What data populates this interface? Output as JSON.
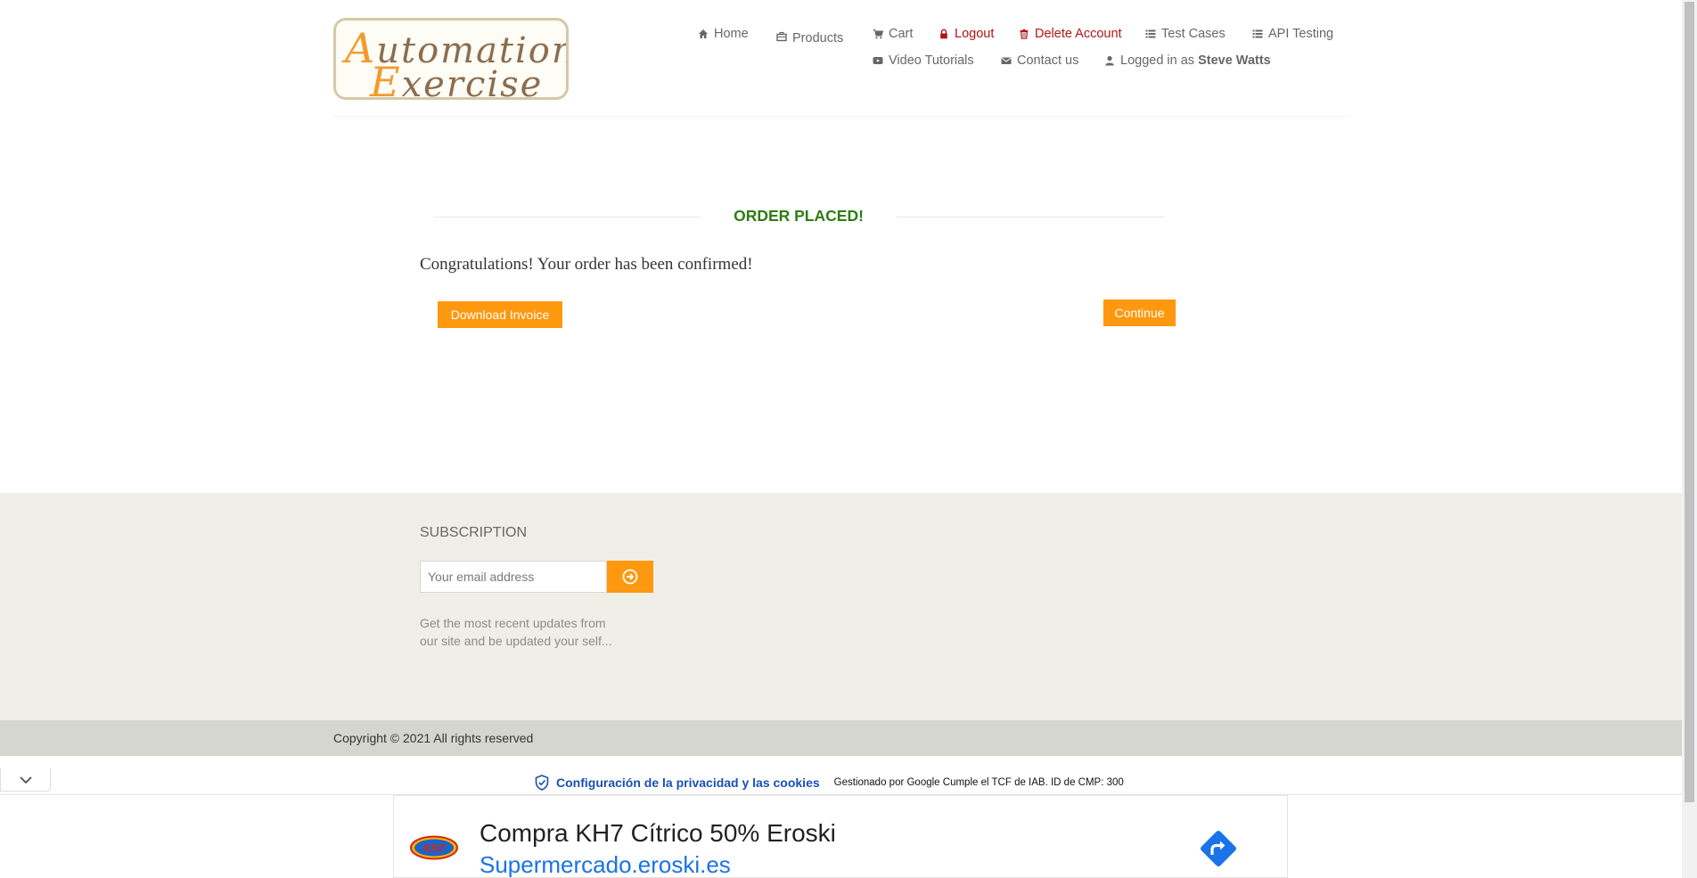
{
  "logo": {
    "line1_cap": "A",
    "line1_rest": "utomation",
    "line2_cap": "E",
    "line2_rest": "xercise"
  },
  "nav": {
    "home": "Home",
    "products": "Products",
    "cart": "Cart",
    "logout": "Logout",
    "delete_account": "Delete Account",
    "test_cases": "Test Cases",
    "api_testing": "API Testing",
    "video_tutorials": "Video Tutorials",
    "contact_us": "Contact us",
    "logged_in_prefix": "Logged in as",
    "logged_in_user": "Steve Watts"
  },
  "main": {
    "title": "ORDER PLACED!",
    "message": "Congratulations! Your order has been confirmed!",
    "download_invoice": "Download Invoice",
    "continue": "Continue"
  },
  "subscription": {
    "title": "SUBSCRIPTION",
    "placeholder": "Your email address",
    "description": "Get the most recent updates from our site and be updated your self..."
  },
  "footer": {
    "copyright": "Copyright © 2021 All rights reserved"
  },
  "cookie_bar": {
    "privacy_link": "Configuración de la privacidad y las cookies",
    "note": "Gestionado por Google Cumple el TCF de IAB. ID de CMP: 300"
  },
  "ad": {
    "logo_text": "KH7",
    "title": "Compra KH7 Cítrico 50% Eroski",
    "url": "Supermercado.eroski.es"
  },
  "colors": {
    "accent": "#fe980f",
    "success": "#2e7d12",
    "danger": "#b0151a",
    "link": "#1a73e8"
  }
}
